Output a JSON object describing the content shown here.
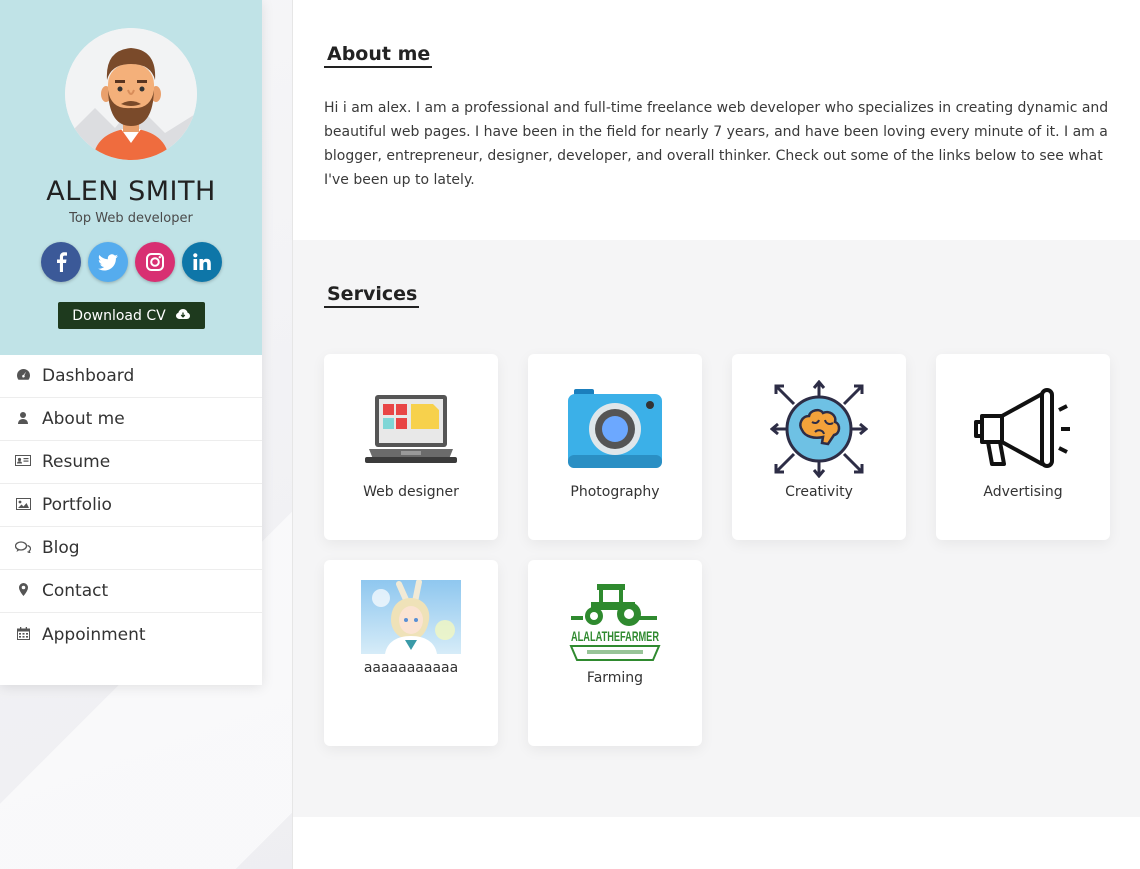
{
  "profile": {
    "name": "ALEN SMITH",
    "role": "Top Web developer",
    "download_label": "Download CV",
    "socials": [
      {
        "name": "facebook",
        "glyph": "f"
      },
      {
        "name": "twitter",
        "glyph": "t"
      },
      {
        "name": "instagram",
        "glyph": "ig"
      },
      {
        "name": "linkedin",
        "glyph": "in"
      }
    ]
  },
  "nav": {
    "items": [
      {
        "label": "Dashboard",
        "icon": "dashboard-icon"
      },
      {
        "label": "About me",
        "icon": "user-icon"
      },
      {
        "label": "Resume",
        "icon": "id-card-icon"
      },
      {
        "label": "Portfolio",
        "icon": "image-icon"
      },
      {
        "label": "Blog",
        "icon": "comments-icon"
      },
      {
        "label": "Contact",
        "icon": "map-marker-icon"
      },
      {
        "label": "Appoinment",
        "icon": "calendar-icon"
      }
    ]
  },
  "about": {
    "title": "About me",
    "text": "Hi i am alex. I am a professional and full-time freelance web developer who specializes in creating dynamic and beautiful web pages. I have been in the field for nearly 7 years, and have been loving every minute of it. I am a blogger, entrepreneur, designer, developer, and overall thinker. Check out some of the links below to see what I've been up to lately."
  },
  "services": {
    "title": "Services",
    "items": [
      {
        "label": "Web designer",
        "icon": "laptop-icon"
      },
      {
        "label": "Photography",
        "icon": "camera-icon"
      },
      {
        "label": "Creativity",
        "icon": "brain-icon"
      },
      {
        "label": "Advertising",
        "icon": "megaphone-icon"
      },
      {
        "label": "aaaaaaaaaaa",
        "icon": "anime-image-icon"
      },
      {
        "label": "Farming",
        "icon": "farm-logo-icon",
        "logo_text": "ALALATHEFARMER"
      }
    ]
  },
  "colors": {
    "profile_bg": "#c0e3e7",
    "cv_button": "#1e3a1e",
    "facebook": "#3b5998",
    "twitter": "#55acee",
    "instagram": "#d82f72",
    "linkedin": "#0e76a8"
  }
}
